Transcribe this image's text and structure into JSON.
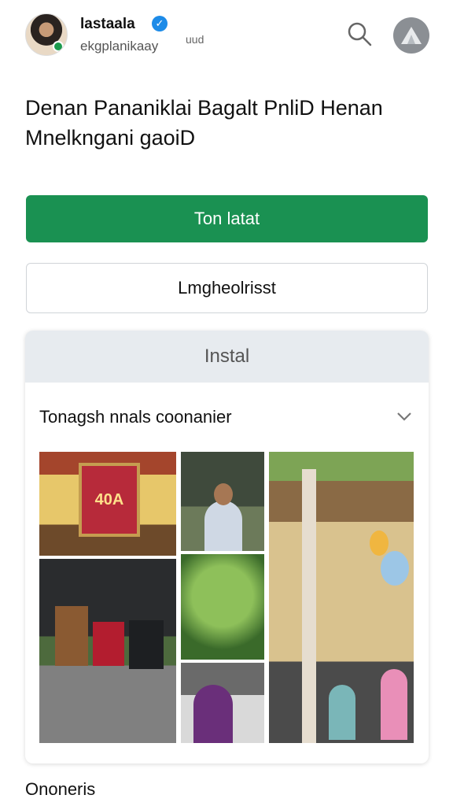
{
  "header": {
    "account_name": "lastaala",
    "account_handle": "ekgplanikaay",
    "handle_suffix": "uud"
  },
  "headline": {
    "line1": "Denan Pananiklai Bagalt PnliD Henan",
    "line2": "Mnelkngani gaoiD"
  },
  "buttons": {
    "primary_label": "Ton latat",
    "secondary_label": "Lmgheolrisst"
  },
  "card": {
    "header_label": "Instal",
    "row_label": "Tonagsh nnals coonanier",
    "sign_text": "40A"
  },
  "footer": {
    "label": "Ononeris"
  },
  "colors": {
    "primary_green": "#1a9152",
    "verified_blue": "#1d8be8",
    "card_header_bg": "#e7ebef"
  },
  "icons": {
    "search": "search-icon",
    "verified": "verified-badge-icon",
    "chevron": "chevron-down-icon",
    "profile": "profile-icon"
  }
}
